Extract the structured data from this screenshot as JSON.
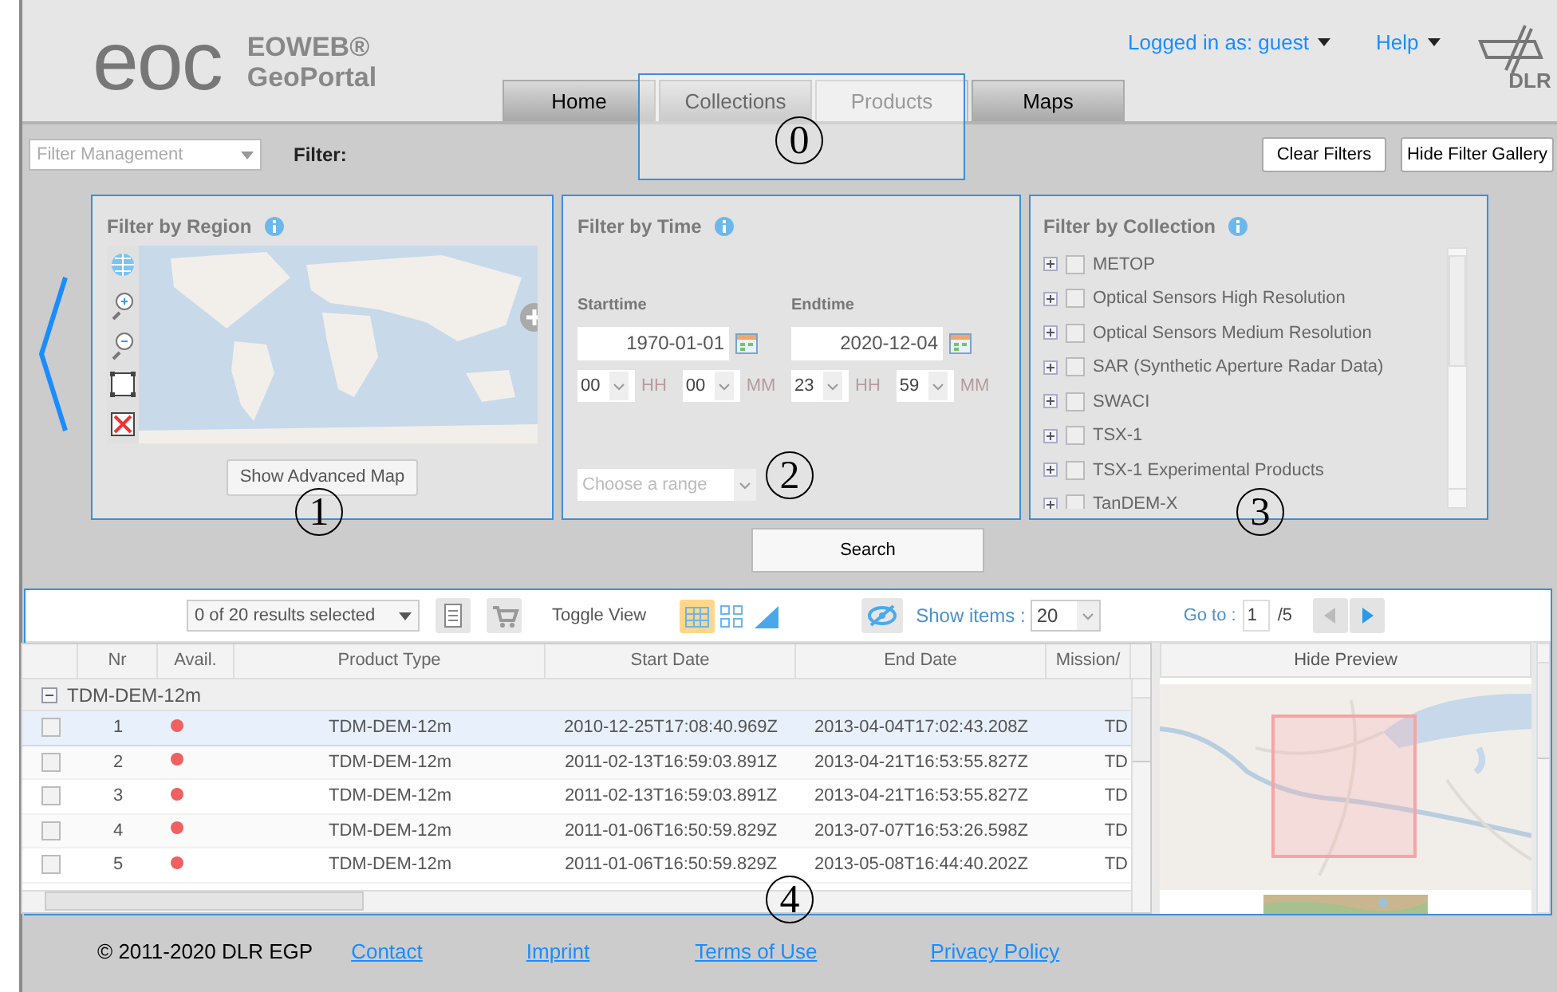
{
  "header": {
    "logo_mark": "eoc",
    "logo_line1": "EOWEB®",
    "logo_line2": "GeoPortal",
    "user_menu": "Logged in as: guest",
    "help_menu": "Help",
    "partner_logo": "DLR"
  },
  "tabs": [
    {
      "label": "Home",
      "selected": false
    },
    {
      "label": "Collections",
      "selected": false
    },
    {
      "label": "Products",
      "selected": true
    },
    {
      "label": "Maps",
      "selected": false
    }
  ],
  "filter_bar": {
    "management": {
      "placeholder": "Filter Management"
    },
    "label": "Filter:",
    "buttons": [
      "Clear Filters",
      "Hide Filter Gallery"
    ]
  },
  "region_filter": {
    "title": "Filter by Region",
    "button": "Show Advanced Map"
  },
  "time_filter": {
    "title": "Filter by Time",
    "start": {
      "label": "Starttime",
      "date": "1970-01-01",
      "hour": "00",
      "hour_unit": "HH",
      "minute": "00",
      "minute_unit": "MM"
    },
    "end": {
      "label": "Endtime",
      "date": "2020-12-04",
      "hour": "23",
      "hour_unit": "HH",
      "minute": "59",
      "minute_unit": "MM"
    },
    "range": {
      "placeholder": "Choose a range"
    }
  },
  "collection_filter": {
    "title": "Filter by Collection",
    "items": [
      {
        "label": "METOP",
        "checked": false
      },
      {
        "label": "Optical Sensors High Resolution",
        "checked": false
      },
      {
        "label": "Optical Sensors Medium Resolution",
        "checked": false
      },
      {
        "label": "SAR (Synthetic Aperture Radar Data)",
        "checked": false
      },
      {
        "label": "SWACI",
        "checked": false
      },
      {
        "label": "TSX-1",
        "checked": false
      },
      {
        "label": "TSX-1 Experimental Products",
        "checked": false
      },
      {
        "label": "TanDEM-X",
        "checked": false
      }
    ]
  },
  "search_button": "Search",
  "results": {
    "selection": "0 of 20 results selected",
    "toggle_label": "Toggle View",
    "views": [
      {
        "kind": "table",
        "selected": true
      },
      {
        "kind": "grid",
        "selected": false
      },
      {
        "kind": "map",
        "selected": false
      }
    ],
    "show_items_label": "Show items :",
    "show_items": "20",
    "goto_label": "Go to :",
    "page": "1",
    "page_count": "/5",
    "columns": [
      "Nr",
      "Avail.",
      "Product Type",
      "Start Date",
      "End Date",
      "Mission/"
    ],
    "group": {
      "label": "TDM-DEM-12m",
      "expanded": true
    },
    "rows": [
      {
        "nr": "1",
        "color": "#f06060",
        "product_type": "TDM-DEM-12m",
        "start_date": "2010-12-25T17:08:40.969Z",
        "end_date": "2013-04-04T17:02:43.208Z",
        "mission": "TD",
        "checked": false,
        "selected": true
      },
      {
        "nr": "2",
        "color": "#f06060",
        "product_type": "TDM-DEM-12m",
        "start_date": "2011-02-13T16:59:03.891Z",
        "end_date": "2013-04-21T16:53:55.827Z",
        "mission": "TD",
        "checked": false,
        "selected": false
      },
      {
        "nr": "3",
        "color": "#f06060",
        "product_type": "TDM-DEM-12m",
        "start_date": "2011-02-13T16:59:03.891Z",
        "end_date": "2013-04-21T16:53:55.827Z",
        "mission": "TD",
        "checked": false,
        "selected": false
      },
      {
        "nr": "4",
        "color": "#f06060",
        "product_type": "TDM-DEM-12m",
        "start_date": "2011-01-06T16:50:59.829Z",
        "end_date": "2013-07-07T16:53:26.598Z",
        "mission": "TD",
        "checked": false,
        "selected": false
      },
      {
        "nr": "5",
        "color": "#f06060",
        "product_type": "TDM-DEM-12m",
        "start_date": "2011-01-06T16:50:59.829Z",
        "end_date": "2013-05-08T16:44:40.202Z",
        "mission": "TD",
        "checked": false,
        "selected": false
      }
    ],
    "preview_button": "Hide Preview"
  },
  "footer": {
    "copyright": "© 2011-2020 DLR EGP",
    "links": [
      "Contact",
      "Imprint",
      "Terms of Use",
      "Privacy Policy"
    ]
  },
  "annotations": [
    {
      "label": "0"
    },
    {
      "label": "1"
    },
    {
      "label": "2"
    },
    {
      "label": "3"
    },
    {
      "label": "4"
    }
  ]
}
